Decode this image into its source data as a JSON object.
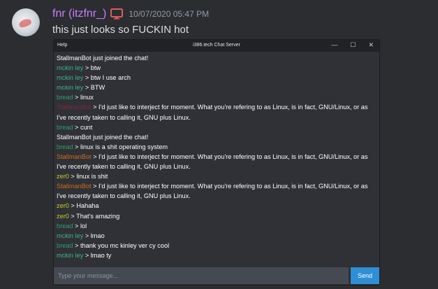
{
  "message": {
    "username": "fnr (itzfnr_)",
    "timestamp": "10/07/2020 05:47 PM",
    "text": "this just looks so FUCKIN hot"
  },
  "window": {
    "menu": "Help",
    "title": "i386.tech Chat Server",
    "controls": [
      "—",
      "☐",
      "✕"
    ],
    "chat": [
      {
        "name": "",
        "text": "StallmanBot just joined the chat!"
      },
      {
        "name": "mckin ley",
        "text": " > btw",
        "cls": "n-mckin"
      },
      {
        "name": "mckin ley",
        "text": " > btw I use arch",
        "cls": "n-mckin"
      },
      {
        "name": "mckin ley",
        "text": " > BTW",
        "cls": "n-mckin"
      },
      {
        "name": "bread",
        "text": " > linux",
        "cls": "n-bread"
      },
      {
        "name": "StallmanBot",
        "text": " > I'd just like to interject for moment. What you're refering to as Linux, is in fact, GNU/Linux, or as I've recently taken to calling it, GNU plus Linux.",
        "cls": "n-stallman-dim",
        "wrap": true
      },
      {
        "name": "bread",
        "text": " > cunt",
        "cls": "n-bread"
      },
      {
        "name": "",
        "text": "StallmanBot just joined the chat!"
      },
      {
        "name": "bread",
        "text": " > linux is a shit operating system",
        "cls": "n-bread"
      },
      {
        "name": "StallmanBot",
        "text": " > I'd just like to interject for moment. What you're refering to as Linux, is in fact, GNU/Linux, or as I've recently taken to calling it, GNU plus Linux.",
        "cls": "n-stallman",
        "wrap": true
      },
      {
        "name": "zer0",
        "text": " > linux is shit",
        "cls": "n-zer0"
      },
      {
        "name": "StallmanBot",
        "text": " > I'd just like to interject for moment. What you're refering to as Linux, is in fact, GNU/Linux, or as I've recently taken to calling it, GNU plus Linux.",
        "cls": "n-stallman",
        "wrap": true
      },
      {
        "name": "zer0",
        "text": " > Hahaha",
        "cls": "n-zer0"
      },
      {
        "name": "zer0",
        "text": " > That's amazing",
        "cls": "n-zer0"
      },
      {
        "name": "bread",
        "text": " > lol",
        "cls": "n-bread"
      },
      {
        "name": "mckin ley",
        "text": " > lmao",
        "cls": "n-mckin"
      },
      {
        "name": "bread",
        "text": " > thank you mc kinley ver cy cool",
        "cls": "n-bread"
      },
      {
        "name": "mckin ley",
        "text": " > lmao ty",
        "cls": "n-mckin"
      }
    ],
    "input_placeholder": "Type your message...",
    "send_label": "Send"
  },
  "colors": {
    "username": "#c77dff",
    "mckinley": "#3eb489",
    "bread": "#2e9e6a",
    "zer0": "#c9c926",
    "stallman": "#d06a19",
    "send": "#2f8fd6"
  },
  "icons": [
    "monitor-icon"
  ]
}
